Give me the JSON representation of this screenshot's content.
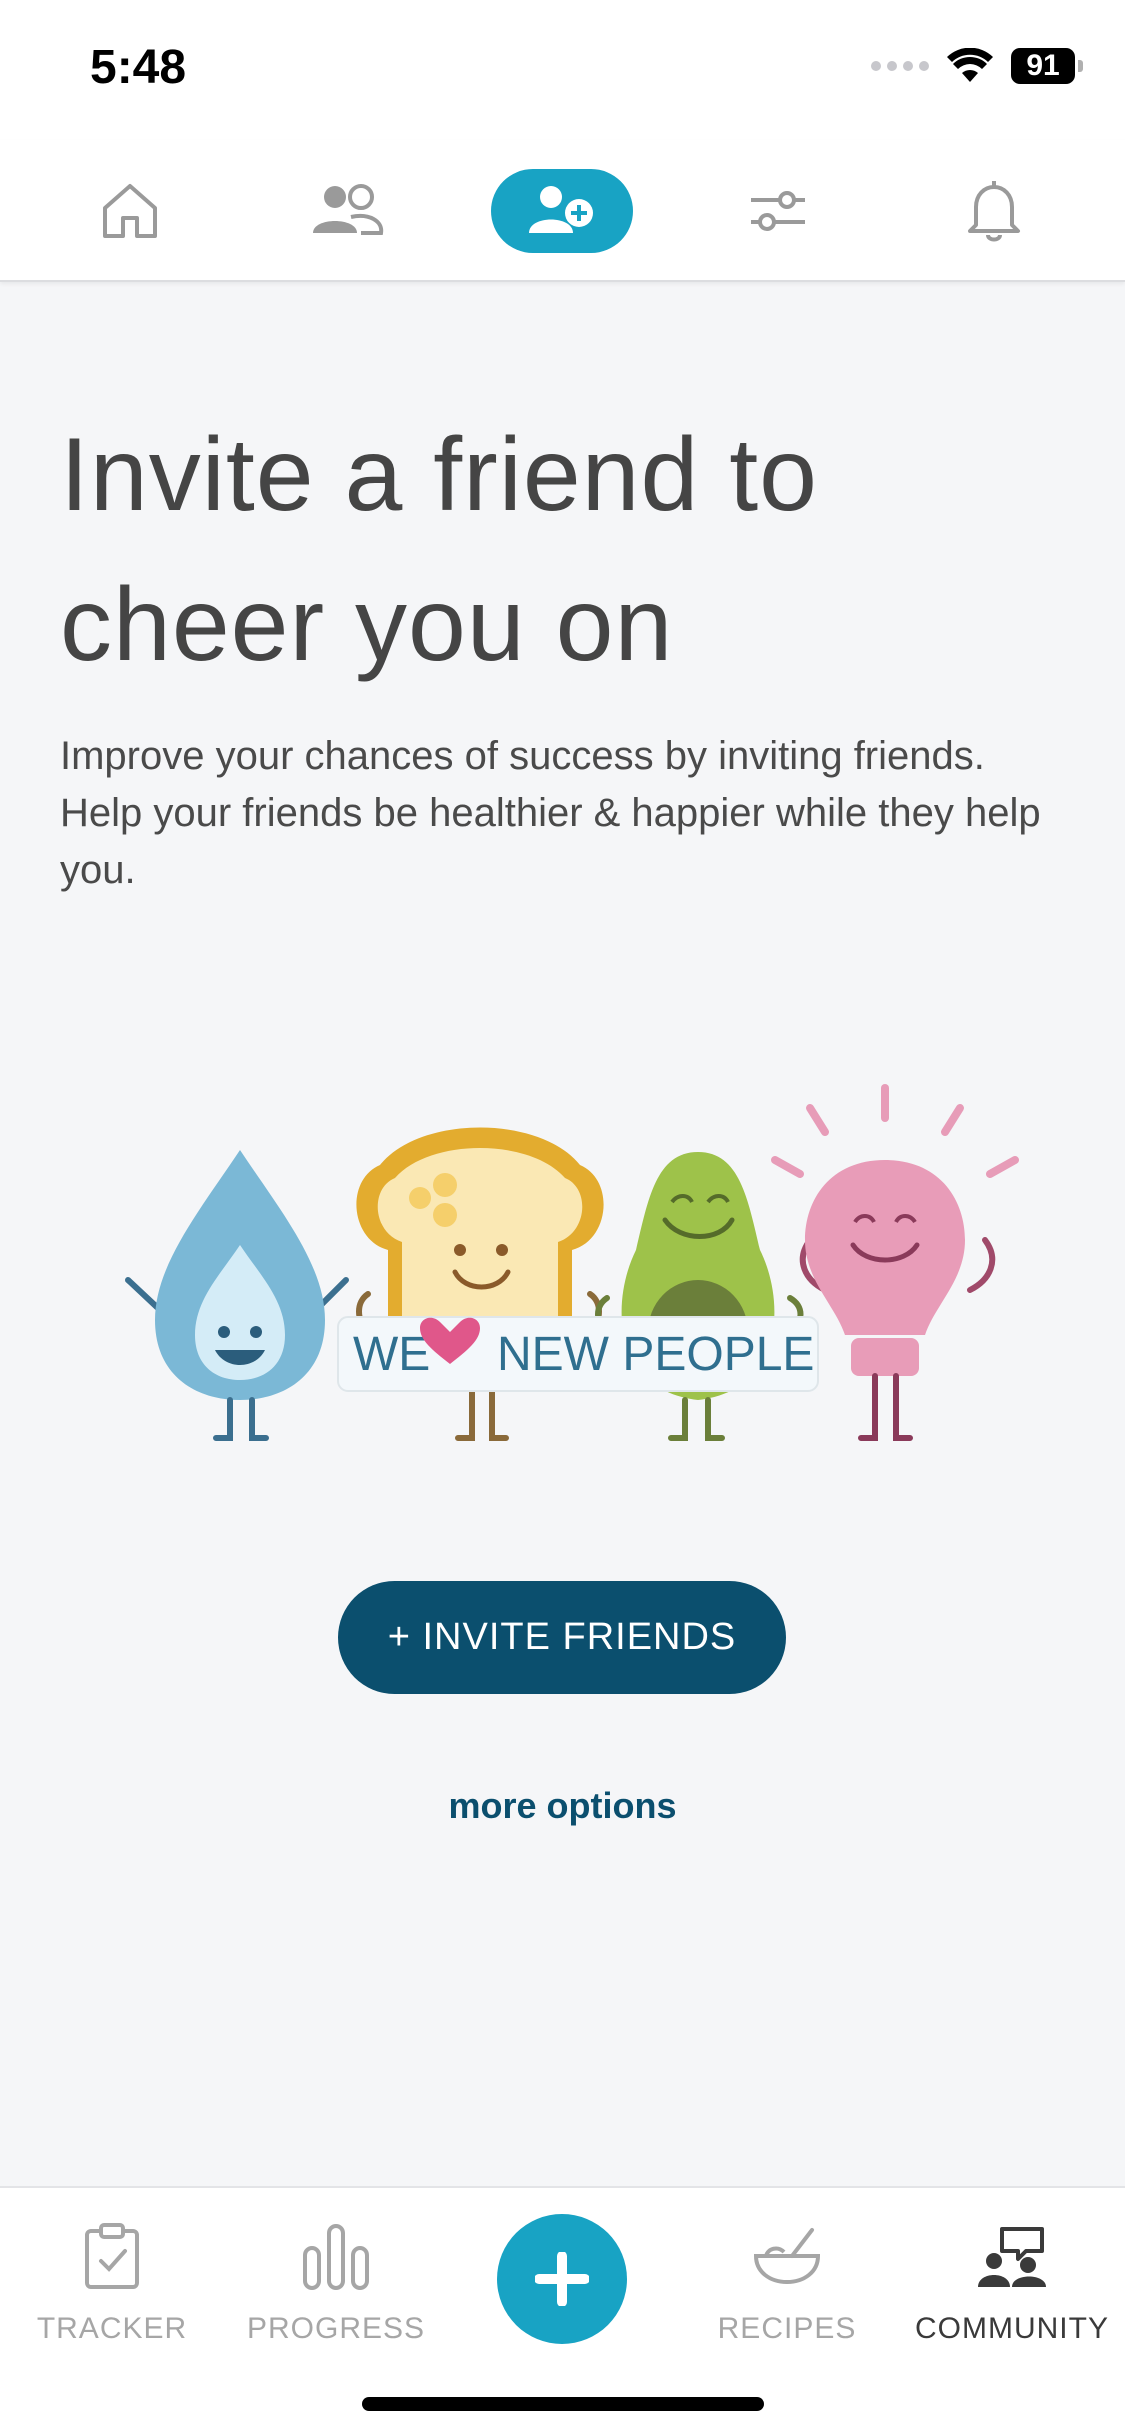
{
  "status_bar": {
    "time": "5:48",
    "battery": "91"
  },
  "top_nav": {
    "items": [
      {
        "name": "home",
        "icon": "home-icon",
        "active": false
      },
      {
        "name": "friends",
        "icon": "people-icon",
        "active": false
      },
      {
        "name": "invite",
        "icon": "add-person-icon",
        "active": true
      },
      {
        "name": "settings",
        "icon": "sliders-icon",
        "active": false
      },
      {
        "name": "notifications",
        "icon": "bell-icon",
        "active": false
      }
    ],
    "active_color": "#18a3c4"
  },
  "main": {
    "headline_line1": "Invite a friend to",
    "headline_line2": "cheer you on",
    "description": "Improve your chances of success by inviting friends. Help your friends be healthier & happier while they help you.",
    "banner_we": "WE",
    "banner_people": "NEW PEOPLE",
    "invite_button_label": "+ INVITE FRIENDS",
    "more_options_label": "more options"
  },
  "tab_bar": {
    "tracker_label": "TRACKER",
    "progress_label": "PROGRESS",
    "recipes_label": "RECIPES",
    "community_label": "COMMUNITY",
    "active_tab": "COMMUNITY"
  },
  "colors": {
    "accent": "#18a3c4",
    "primary_dark": "#0b4f6e",
    "heart": "#e0578a"
  }
}
